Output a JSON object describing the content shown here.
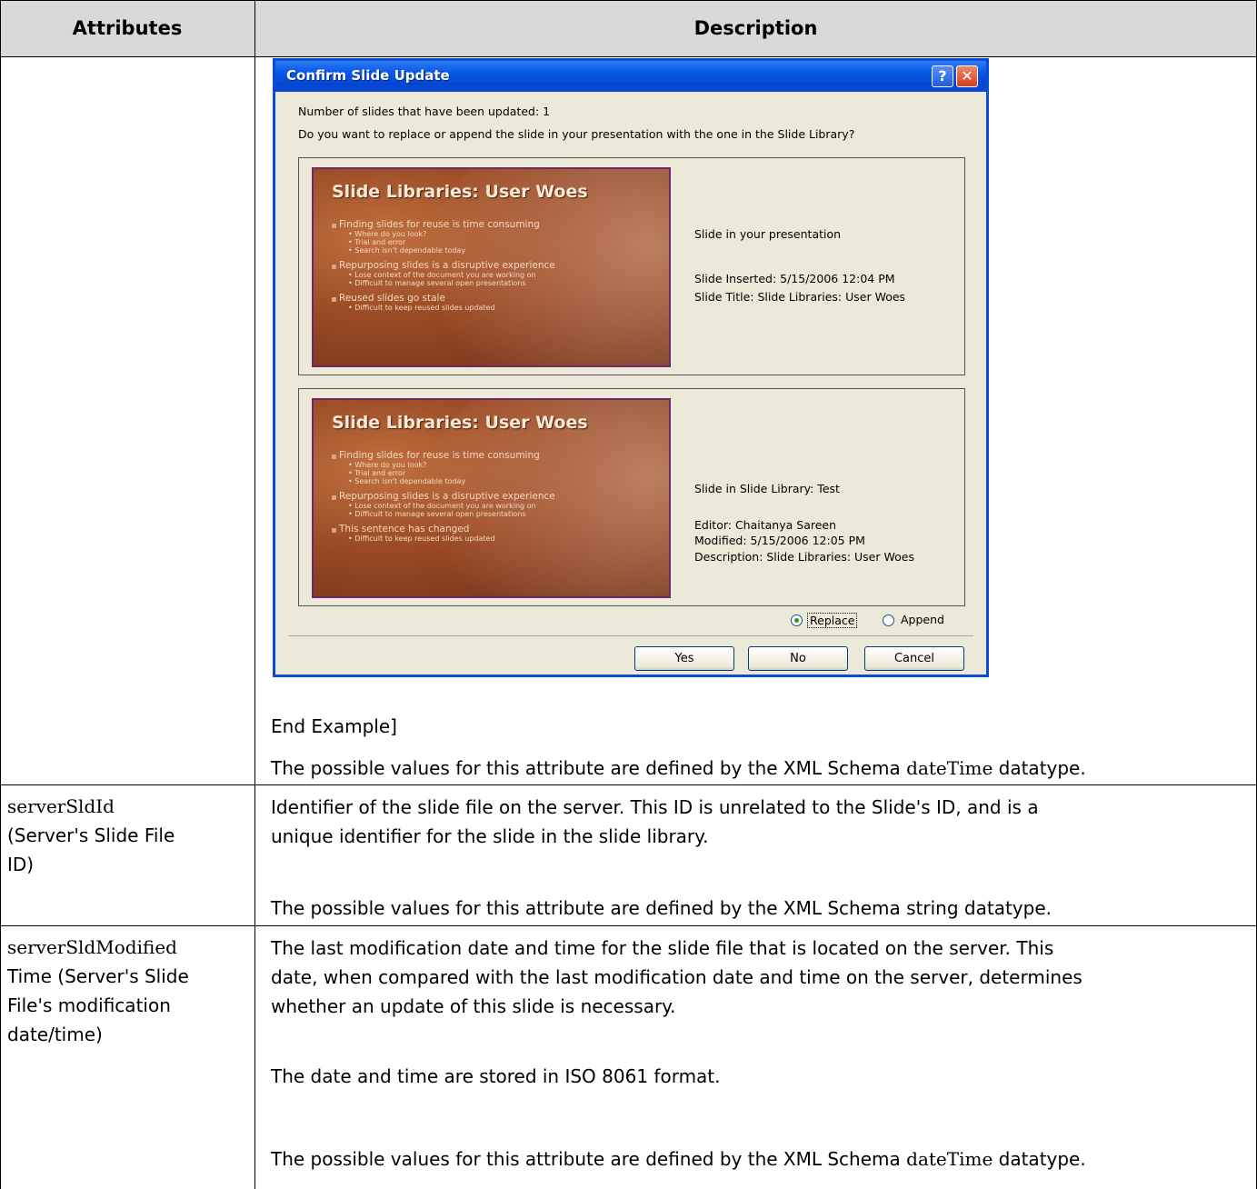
{
  "table": {
    "headers": [
      "Attributes",
      "Description"
    ],
    "row1": {
      "end_example": "End Example]",
      "values_line": [
        "The possible values for this attribute are defined by the XML Schema ",
        "dateTime",
        " datatype."
      ]
    },
    "row2": {
      "attr_lines": [
        "serverSldId",
        "(Server's Slide File",
        "ID)"
      ],
      "desc_lines": [
        "Identifier of the slide file on the server. This ID is unrelated to the Slide's ID, and is a",
        "unique identifier for the slide in the slide library."
      ],
      "values_line": "The possible values for this attribute are defined by the XML Schema string datatype."
    },
    "row3": {
      "attr_lines": [
        "serverSldModified",
        "Time (Server's Slide",
        "File's modification",
        "date/time)"
      ],
      "desc_lines": [
        "The last modification date and time for the slide file that is located on the server. This",
        "date, when compared with the last modification date and time on the server, determines",
        "whether an update of this slide is necessary."
      ],
      "iso_line": "The date and time are stored in ISO 8061 format.",
      "values_line": [
        "The possible values for this attribute are defined by the XML Schema ",
        "dateTime",
        " datatype."
      ]
    }
  },
  "dialog": {
    "title": "Confirm Slide Update",
    "help_glyph": "?",
    "close_glyph": "✕",
    "line1": "Number of slides that have been updated: 1",
    "line2": "Do you want to replace or append the slide in your presentation with the one in the Slide Library?",
    "slide_title": "Slide Libraries: User Woes",
    "slide1_bullets": [
      {
        "level": 1,
        "text": "Finding slides for reuse is time consuming"
      },
      {
        "level": 2,
        "text": "Where do you look?"
      },
      {
        "level": 2,
        "text": "Trial and error"
      },
      {
        "level": 2,
        "text": "Search isn't dependable today"
      },
      {
        "level": 1,
        "text": "Repurposing slides is a disruptive experience"
      },
      {
        "level": 2,
        "text": "Lose context of the document you are working on"
      },
      {
        "level": 2,
        "text": "Difficult to manage several open presentations"
      },
      {
        "level": 1,
        "text": "Reused slides go stale"
      },
      {
        "level": 2,
        "text": "Difficult to keep reused slides updated"
      }
    ],
    "slide2_bullets": [
      {
        "level": 1,
        "text": "Finding slides for reuse is time consuming"
      },
      {
        "level": 2,
        "text": "Where do you look?"
      },
      {
        "level": 2,
        "text": "Trial and error"
      },
      {
        "level": 2,
        "text": "Search isn't dependable today"
      },
      {
        "level": 1,
        "text": "Repurposing slides is a disruptive experience"
      },
      {
        "level": 2,
        "text": "Lose context of the document you are working on"
      },
      {
        "level": 2,
        "text": "Difficult to manage several open presentations"
      },
      {
        "level": 1,
        "text": "This sentence has changed"
      },
      {
        "level": 2,
        "text": "Difficult to keep reused slides updated"
      }
    ],
    "panel1": {
      "heading": "Slide in your presentation",
      "inserted": "Slide Inserted: 5/15/2006 12:04 PM",
      "title": "Slide Title: Slide Libraries: User Woes"
    },
    "panel2": {
      "heading": "Slide in Slide Library: Test",
      "editor": "Editor: Chaitanya Sareen",
      "modified": "Modified: 5/15/2006 12:05 PM",
      "description": "Description: Slide Libraries: User Woes"
    },
    "radio_replace": "Replace",
    "radio_append": "Append",
    "btn_yes": "Yes",
    "btn_no": "No",
    "btn_cancel": "Cancel"
  }
}
